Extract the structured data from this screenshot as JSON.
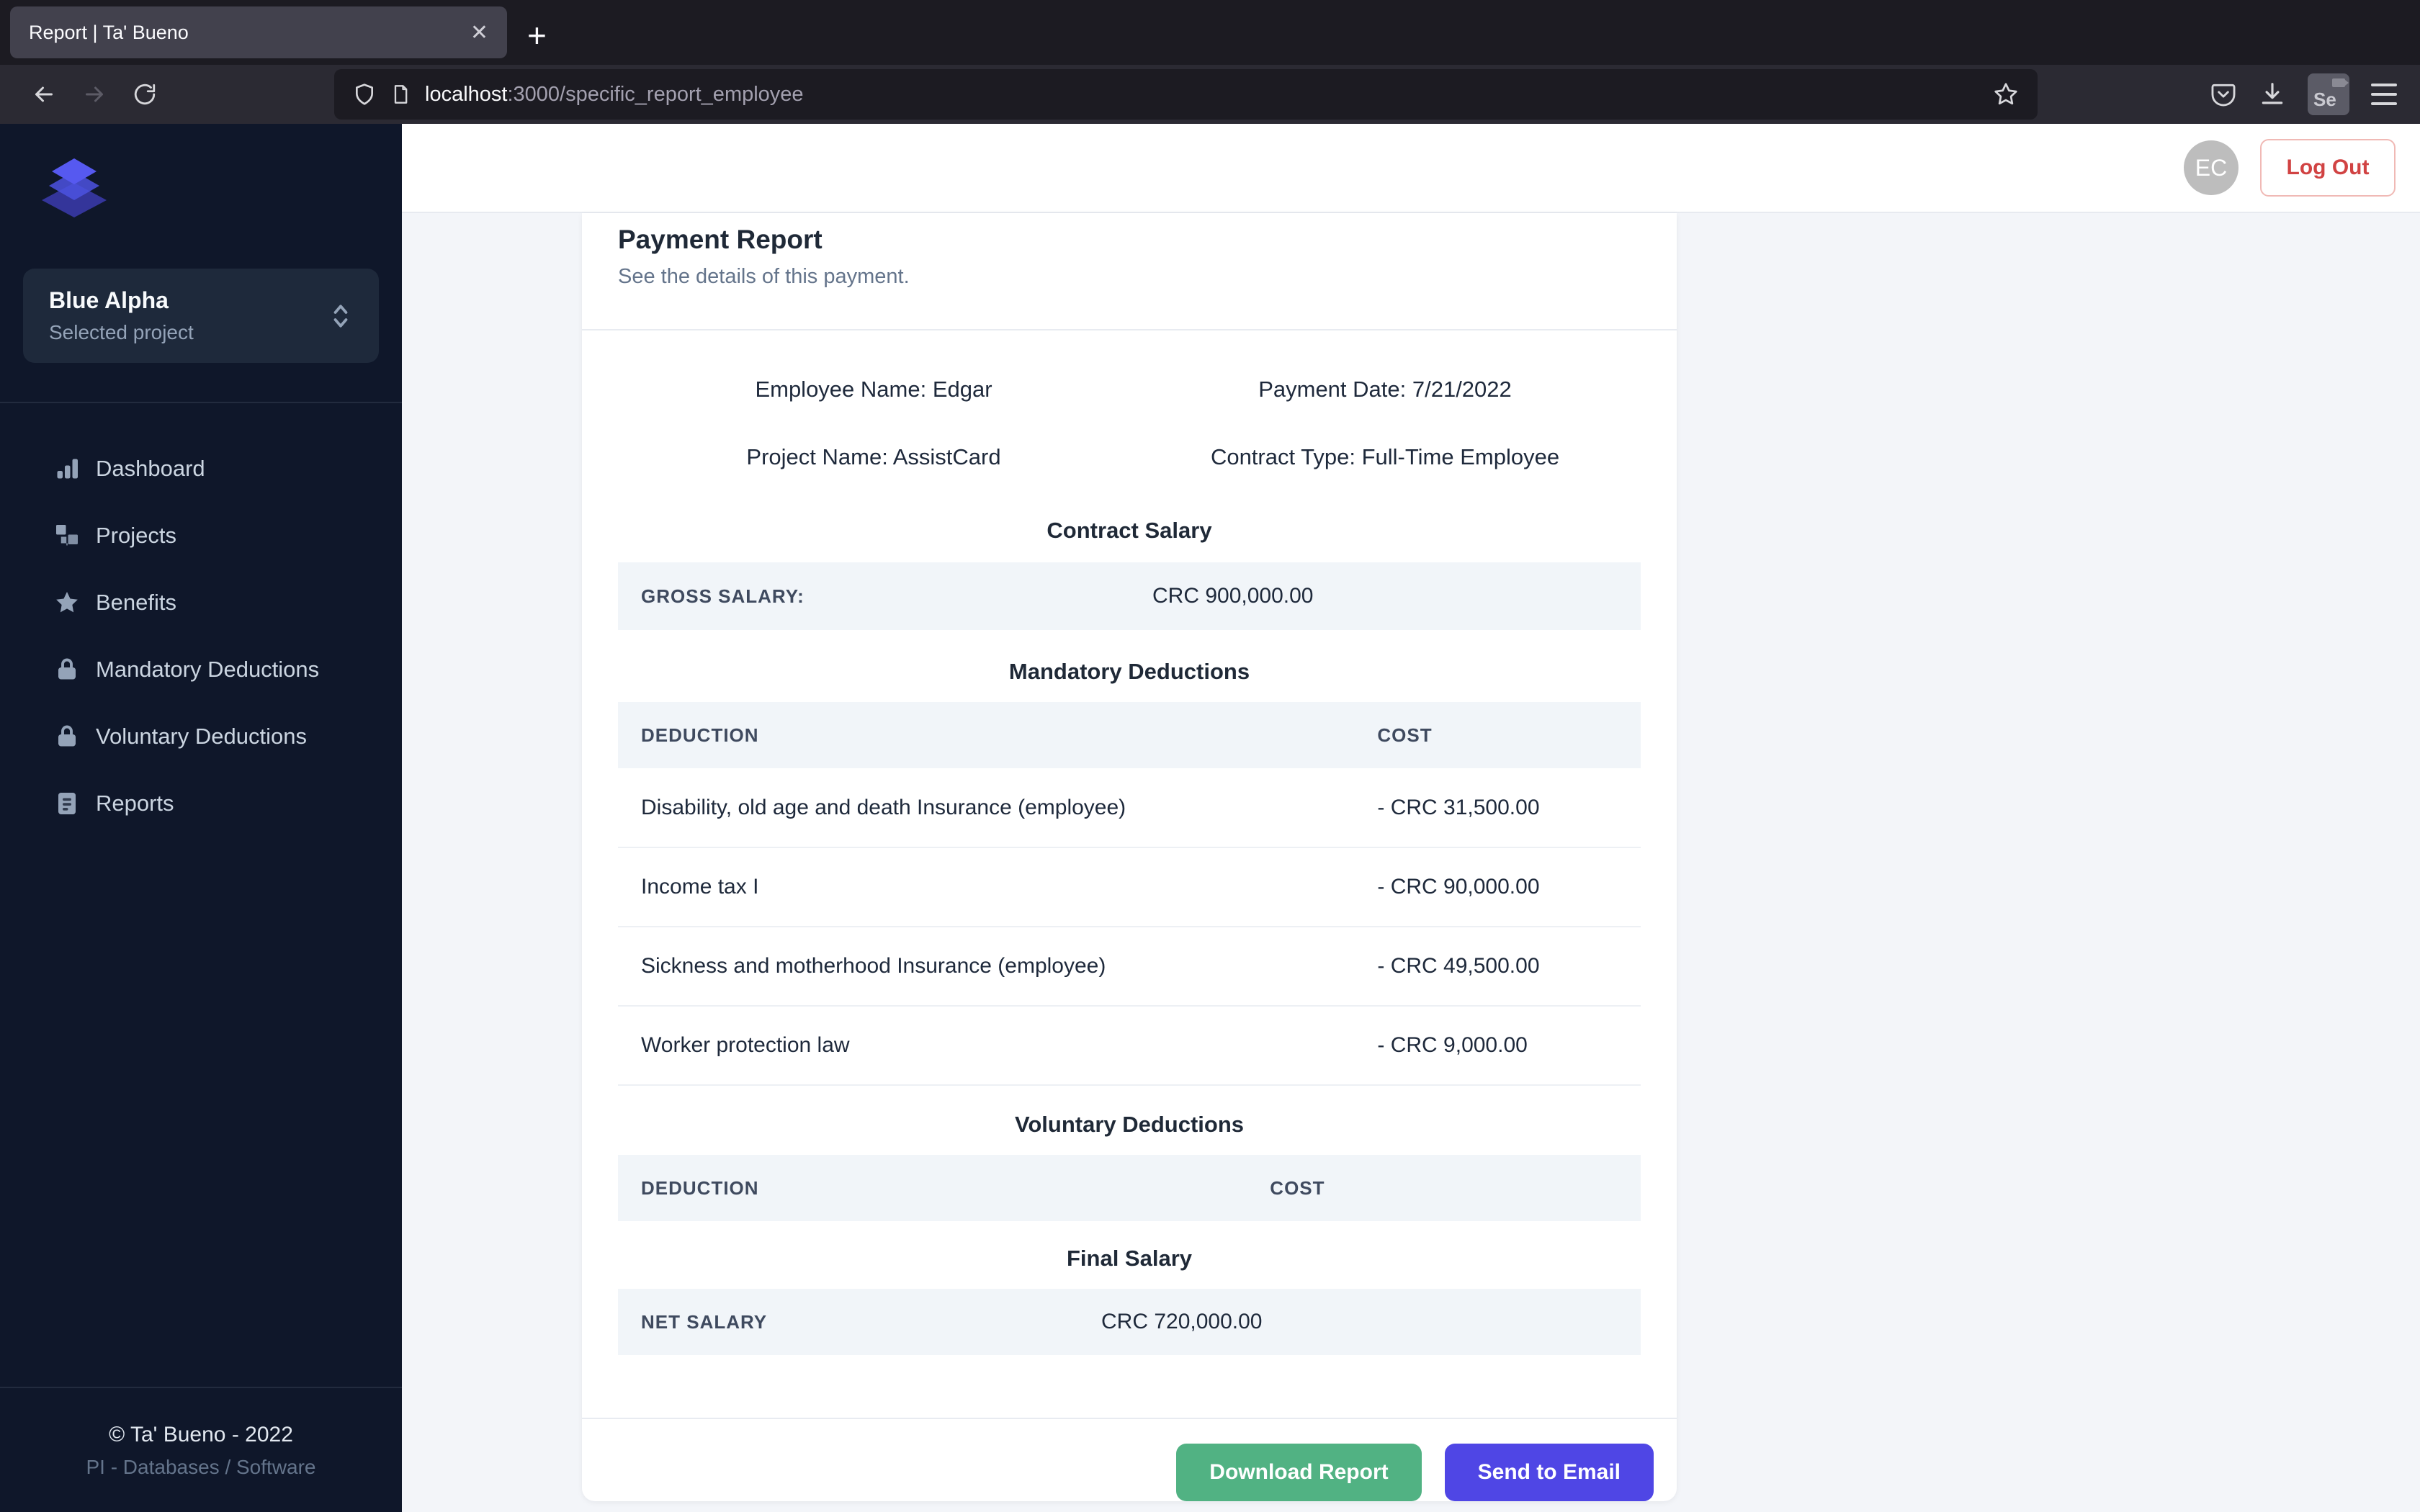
{
  "browser": {
    "tab_title": "Report | Ta' Bueno",
    "close_glyph": "✕",
    "new_tab_glyph": "+",
    "url": {
      "domain": "localhost",
      "path": ":3000/specific_report_employee"
    },
    "se_badge": "Se"
  },
  "sidebar": {
    "project": {
      "name": "Blue Alpha",
      "subtitle": "Selected project"
    },
    "items": [
      {
        "label": "Dashboard"
      },
      {
        "label": "Projects"
      },
      {
        "label": "Benefits"
      },
      {
        "label": "Mandatory Deductions"
      },
      {
        "label": "Voluntary Deductions"
      },
      {
        "label": "Reports"
      }
    ],
    "footer": {
      "line1": "© Ta' Bueno - 2022",
      "line2": "PI - Databases / Software"
    }
  },
  "header": {
    "avatar_initials": "EC",
    "logout_label": "Log Out"
  },
  "report": {
    "title": "Payment Report",
    "subtitle": "See the details of this payment.",
    "details": [
      "Employee Name: Edgar",
      "Payment Date: 7/21/2022",
      "Project Name: AssistCard",
      "Contract Type: Full-Time Employee"
    ],
    "contract_salary": {
      "heading": "Contract Salary",
      "label": "GROSS SALARY:",
      "value": "CRC 900,000.00"
    },
    "mandatory": {
      "heading": "Mandatory Deductions",
      "col_deduction": "DEDUCTION",
      "col_cost": "COST",
      "rows": [
        {
          "name": "Disability, old age and death Insurance (employee)",
          "cost": "- CRC 31,500.00"
        },
        {
          "name": "Income tax I",
          "cost": "- CRC 90,000.00"
        },
        {
          "name": "Sickness and motherhood Insurance (employee)",
          "cost": "- CRC 49,500.00"
        },
        {
          "name": "Worker protection law",
          "cost": "- CRC 9,000.00"
        }
      ]
    },
    "voluntary": {
      "heading": "Voluntary Deductions",
      "col_deduction": "DEDUCTION",
      "col_cost": "COST",
      "rows": []
    },
    "final_salary": {
      "heading": "Final Salary",
      "label": "NET SALARY",
      "value": "CRC 720,000.00"
    },
    "actions": {
      "download": "Download Report",
      "send": "Send to Email"
    }
  },
  "colors": {
    "accent_green": "#51B283",
    "accent_indigo": "#4F46E5",
    "logout_red": "#D14343",
    "sidebar_bg": "#0F172A",
    "content_bg": "#F3F5F9"
  }
}
